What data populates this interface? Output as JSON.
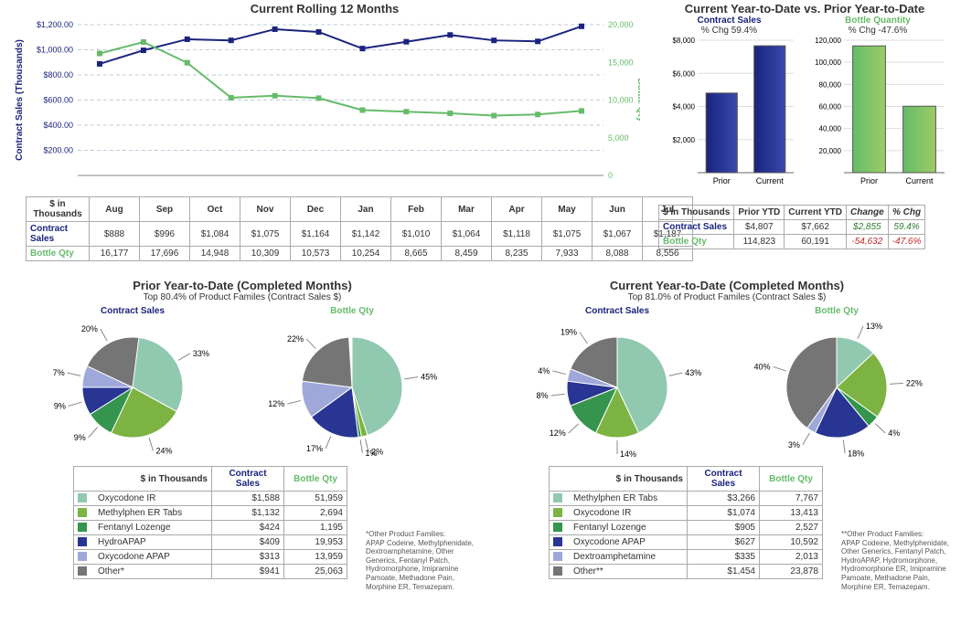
{
  "chart_data": [
    {
      "id": "rolling12",
      "type": "line",
      "title": "Current Rolling 12 Months",
      "x": [
        "Aug",
        "Sep",
        "Oct",
        "Nov",
        "Dec",
        "Jan",
        "Feb",
        "Mar",
        "Apr",
        "May",
        "Jun",
        "Jul"
      ],
      "series": [
        {
          "name": "Contract Sales",
          "axis": "left",
          "color": "#1a237e",
          "values": [
            888,
            996,
            1084,
            1075,
            1164,
            1142,
            1010,
            1064,
            1118,
            1075,
            1067,
            1187
          ]
        },
        {
          "name": "Bottle Qty",
          "axis": "right",
          "color": "#66bb6a",
          "values": [
            16177,
            17696,
            14948,
            10309,
            10573,
            10254,
            8665,
            8459,
            8235,
            7933,
            8088,
            8556
          ]
        }
      ],
      "ylabel_left": "Contract Sales (Thousands)",
      "ylabel_right": "Bottle Qty",
      "left_ticks": [
        "$200.00",
        "$400.00",
        "$600.00",
        "$800.00",
        "$1,000.00",
        "$1,200.00"
      ],
      "right_ticks": [
        "0",
        "5,000",
        "10,000",
        "15,000",
        "20,000"
      ]
    },
    {
      "id": "ytd_bars",
      "type": "bar",
      "title": "Current Year-to-Date vs. Prior Year-to-Date",
      "subcharts": [
        {
          "name": "Contract Sales",
          "pct_label": "% Chg 59.4%",
          "color": "#1a237e",
          "categories": [
            "Prior",
            "Current"
          ],
          "values": [
            4807,
            7662
          ],
          "ymax": 8000,
          "ticks": [
            "$2,000",
            "$4,000",
            "$6,000",
            "$8,000"
          ]
        },
        {
          "name": "Bottle Quantity",
          "pct_label": "% Chg -47.6%",
          "color": "#66bb6a",
          "categories": [
            "Prior",
            "Current"
          ],
          "values": [
            114823,
            60191
          ],
          "ymax": 120000,
          "ticks": [
            "20,000",
            "40,000",
            "60,000",
            "80,000",
            "100,000",
            "120,000"
          ]
        }
      ]
    },
    {
      "id": "pie_prior_sales",
      "type": "pie",
      "title": "Contract Sales",
      "slices": [
        {
          "label": "33%",
          "v": 33,
          "c": "#90c8b0"
        },
        {
          "label": "24%",
          "v": 24,
          "c": "#7cb342"
        },
        {
          "label": "9%",
          "v": 9,
          "c": "#35944e"
        },
        {
          "label": "9%",
          "v": 9,
          "c": "#283593"
        },
        {
          "label": "7%",
          "v": 7,
          "c": "#9fa8da"
        },
        {
          "label": "20%",
          "v": 20,
          "c": "#757575"
        }
      ]
    },
    {
      "id": "pie_prior_qty",
      "type": "pie",
      "title": "Bottle Qty",
      "slices": [
        {
          "label": "45%",
          "v": 45,
          "c": "#90c8b0"
        },
        {
          "label": "2%",
          "v": 2,
          "c": "#7cb342"
        },
        {
          "label": "1%",
          "v": 1,
          "c": "#35944e"
        },
        {
          "label": "17%",
          "v": 17,
          "c": "#283593"
        },
        {
          "label": "12%",
          "v": 12,
          "c": "#9fa8da"
        },
        {
          "label": "22%",
          "v": 22,
          "c": "#757575"
        }
      ]
    },
    {
      "id": "pie_cur_sales",
      "type": "pie",
      "title": "Contract Sales",
      "slices": [
        {
          "label": "43%",
          "v": 43,
          "c": "#90c8b0"
        },
        {
          "label": "14%",
          "v": 14,
          "c": "#7cb342"
        },
        {
          "label": "12%",
          "v": 12,
          "c": "#35944e"
        },
        {
          "label": "8%",
          "v": 8,
          "c": "#283593"
        },
        {
          "label": "4%",
          "v": 4,
          "c": "#9fa8da"
        },
        {
          "label": "19%",
          "v": 19,
          "c": "#757575"
        }
      ]
    },
    {
      "id": "pie_cur_qty",
      "type": "pie",
      "title": "Bottle Qty",
      "slices": [
        {
          "label": "13%",
          "v": 13,
          "c": "#90c8b0"
        },
        {
          "label": "22%",
          "v": 22,
          "c": "#7cb342"
        },
        {
          "label": "4%",
          "v": 4,
          "c": "#35944e"
        },
        {
          "label": "18%",
          "v": 18,
          "c": "#283593"
        },
        {
          "label": "3%",
          "v": 3,
          "c": "#9fa8da"
        },
        {
          "label": "40%",
          "v": 40,
          "c": "#757575"
        }
      ]
    }
  ],
  "rolling_table": {
    "corner": "$ in Thousands",
    "months": [
      "Aug",
      "Sep",
      "Oct",
      "Nov",
      "Dec",
      "Jan",
      "Feb",
      "Mar",
      "Apr",
      "May",
      "Jun",
      "Jul"
    ],
    "rows": [
      {
        "label": "Contract Sales",
        "class": "col-navy",
        "vals": [
          "$888",
          "$996",
          "$1,084",
          "$1,075",
          "$1,164",
          "$1,142",
          "$1,010",
          "$1,064",
          "$1,118",
          "$1,075",
          "$1,067",
          "$1,187"
        ]
      },
      {
        "label": "Bottle Qty",
        "class": "col-green",
        "vals": [
          "16,177",
          "17,696",
          "14,948",
          "10,309",
          "10,573",
          "10,254",
          "8,665",
          "8,459",
          "8,235",
          "7,933",
          "8,088",
          "8,556"
        ]
      }
    ]
  },
  "ytd_table": {
    "corner": "$ in Thousands",
    "headers": [
      "Prior YTD",
      "Current YTD",
      "Change",
      "% Chg"
    ],
    "rows": [
      {
        "label": "Contract Sales",
        "class": "col-navy",
        "vals": [
          "$4,807",
          "$7,662",
          "$2,855",
          "59.4%"
        ],
        "cls": [
          "",
          "",
          "pos ital",
          "pos ital"
        ]
      },
      {
        "label": "Bottle Qty",
        "class": "col-green",
        "vals": [
          "114,823",
          "60,191",
          "-54,632",
          "-47.6%"
        ],
        "cls": [
          "",
          "",
          "neg ital",
          "neg ital"
        ]
      }
    ]
  },
  "prior_section": {
    "title": "Prior Year-to-Date (Completed Months)",
    "subtitle": "Top 80.4% of Product Familes (Contract Sales $)",
    "p1": "Contract Sales",
    "p2": "Bottle Qty",
    "corner": "$ in Thousands",
    "h1": "Contract Sales",
    "h2": "Bottle Qty",
    "rows": [
      {
        "c": "#90c8b0",
        "name": "Oxycodone IR",
        "v1": "$1,588",
        "v2": "51,959"
      },
      {
        "c": "#7cb342",
        "name": "Methylphen ER Tabs",
        "v1": "$1,132",
        "v2": "2,694"
      },
      {
        "c": "#35944e",
        "name": "Fentanyl Lozenge",
        "v1": "$424",
        "v2": "1,195"
      },
      {
        "c": "#283593",
        "name": "HydroAPAP",
        "v1": "$409",
        "v2": "19,953"
      },
      {
        "c": "#9fa8da",
        "name": "Oxycodone APAP",
        "v1": "$313",
        "v2": "13,959"
      },
      {
        "c": "#757575",
        "name": "Other*",
        "v1": "$941",
        "v2": "25,063"
      }
    ],
    "foot_title": "*Other Product Families:",
    "foot_text": "APAP Codeine, Methylphenidate, Dextroamphetamine, Other Generics, Fentanyl Patch, Hydromorphone, Imipramine Pamoate, Methadone Pain, Morphine ER, Temazepam."
  },
  "cur_section": {
    "title": "Current Year-to-Date (Completed Months)",
    "subtitle": "Top 81.0% of Product Familes (Contract Sales $)",
    "p1": "Contract Sales",
    "p2": "Bottle Qty",
    "corner": "$ in Thousands",
    "h1": "Contract Sales",
    "h2": "Bottle Qty",
    "rows": [
      {
        "c": "#90c8b0",
        "name": "Methylphen ER Tabs",
        "v1": "$3,266",
        "v2": "7,767"
      },
      {
        "c": "#7cb342",
        "name": "Oxycodone IR",
        "v1": "$1,074",
        "v2": "13,413"
      },
      {
        "c": "#35944e",
        "name": "Fentanyl Lozenge",
        "v1": "$905",
        "v2": "2,527"
      },
      {
        "c": "#283593",
        "name": "Oxycodone APAP",
        "v1": "$627",
        "v2": "10,592"
      },
      {
        "c": "#9fa8da",
        "name": "Dextroamphetamine",
        "v1": "$335",
        "v2": "2,013"
      },
      {
        "c": "#757575",
        "name": "Other**",
        "v1": "$1,454",
        "v2": "23,878"
      }
    ],
    "foot_title": "**Other Product Families:",
    "foot_text": "APAP Codeine, Methylphenidate, Other Generics, Fentanyl Patch, HydroAPAP, Hydromorphone, Hydromorphone ER, Imipramine Pamoate, Methadone Pain, Morphine ER, Temazepam."
  }
}
